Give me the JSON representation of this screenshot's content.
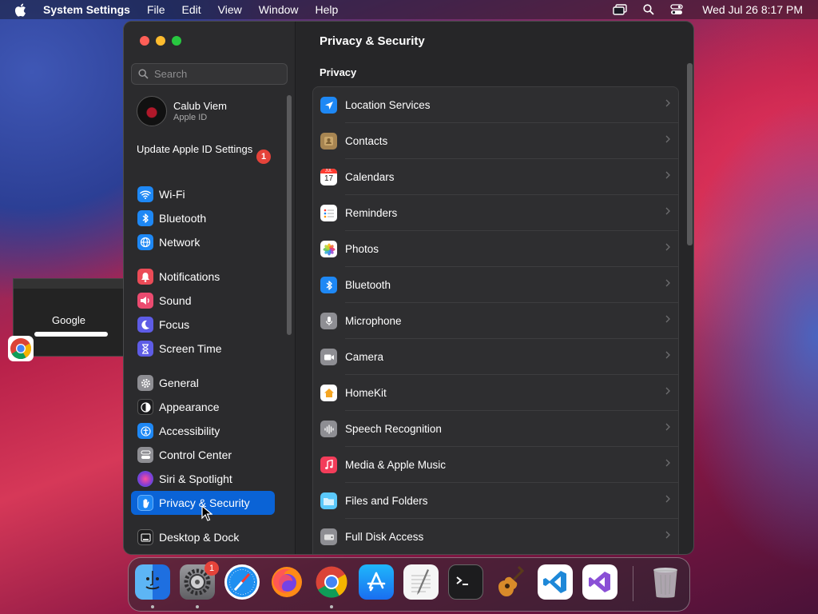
{
  "menubar": {
    "app_name": "System Settings",
    "menus": [
      "File",
      "Edit",
      "View",
      "Window",
      "Help"
    ],
    "datetime": "Wed Jul 26  8:17 PM"
  },
  "background_thumbnail": {
    "label": "Google"
  },
  "window": {
    "search_placeholder": "Search",
    "profile": {
      "name": "Calub Viem",
      "subtitle": "Apple ID"
    },
    "update": {
      "label": "Update Apple ID Settings",
      "badge": "1"
    },
    "sidebar": {
      "items": [
        {
          "label": "Wi-Fi",
          "icon": "wifi-icon",
          "color": "#1e88f5"
        },
        {
          "label": "Bluetooth",
          "icon": "bluetooth-icon",
          "color": "#1e88f5"
        },
        {
          "label": "Network",
          "icon": "globe-icon",
          "color": "#1e88f5"
        },
        {
          "label": "Notifications",
          "icon": "bell-icon",
          "color": "#eb4b57"
        },
        {
          "label": "Sound",
          "icon": "speaker-icon",
          "color": "#eb4b70"
        },
        {
          "label": "Focus",
          "icon": "moon-icon",
          "color": "#5e5ce6"
        },
        {
          "label": "Screen Time",
          "icon": "hourglass-icon",
          "color": "#5e5ce6"
        },
        {
          "label": "General",
          "icon": "gear-icon",
          "color": "#8e8e93"
        },
        {
          "label": "Appearance",
          "icon": "appearance-icon",
          "color": "#1c1c1e"
        },
        {
          "label": "Accessibility",
          "icon": "accessibility-icon",
          "color": "#1e88f5"
        },
        {
          "label": "Control Center",
          "icon": "control-center-icon",
          "color": "#8e8e93"
        },
        {
          "label": "Siri & Spotlight",
          "icon": "siri-icon",
          "color": "#b340c8"
        },
        {
          "label": "Privacy & Security",
          "icon": "hand-icon",
          "color": "#1e88f5",
          "selected": true
        },
        {
          "label": "Desktop & Dock",
          "icon": "desktop-icon",
          "color": "#1c1c1e"
        }
      ]
    },
    "content": {
      "title": "Privacy & Security",
      "section": "Privacy",
      "rows": [
        {
          "label": "Location Services",
          "icon": "location-arrow-icon",
          "color": "#1e88f5"
        },
        {
          "label": "Contacts",
          "icon": "contacts-icon",
          "color": "#a78552"
        },
        {
          "label": "Calendars",
          "icon": "calendar-icon",
          "color": "#ffffff"
        },
        {
          "label": "Reminders",
          "icon": "reminders-icon",
          "color": "#ffffff"
        },
        {
          "label": "Photos",
          "icon": "photos-icon",
          "color": "#ffffff"
        },
        {
          "label": "Bluetooth",
          "icon": "bluetooth-icon",
          "color": "#1e88f5"
        },
        {
          "label": "Microphone",
          "icon": "microphone-icon",
          "color": "#8e8e93"
        },
        {
          "label": "Camera",
          "icon": "camera-icon",
          "color": "#8e8e93"
        },
        {
          "label": "HomeKit",
          "icon": "home-icon",
          "color": "#f5a623"
        },
        {
          "label": "Speech Recognition",
          "icon": "waveform-icon",
          "color": "#8e8e93"
        },
        {
          "label": "Media & Apple Music",
          "icon": "music-note-icon",
          "color": "#f33d5a"
        },
        {
          "label": "Files and Folders",
          "icon": "folder-icon",
          "color": "#5ac8fa"
        },
        {
          "label": "Full Disk Access",
          "icon": "disk-icon",
          "color": "#8e8e93"
        }
      ],
      "calendar_month": "JUL",
      "calendar_day": "17"
    }
  },
  "dock": {
    "apps": [
      {
        "name": "Finder",
        "icon": "finder-icon",
        "running": true
      },
      {
        "name": "System Settings",
        "icon": "system-settings-icon",
        "running": true,
        "badge": "1"
      },
      {
        "name": "Safari",
        "icon": "safari-icon",
        "running": false
      },
      {
        "name": "Firefox",
        "icon": "firefox-icon",
        "running": false
      },
      {
        "name": "Google Chrome",
        "icon": "chrome-icon",
        "running": true
      },
      {
        "name": "App Store",
        "icon": "app-store-icon",
        "running": false
      },
      {
        "name": "TextEdit",
        "icon": "textedit-icon",
        "running": false
      },
      {
        "name": "Terminal",
        "icon": "terminal-icon",
        "running": false
      },
      {
        "name": "GarageBand",
        "icon": "guitar-icon",
        "running": false
      },
      {
        "name": "Visual Studio Code",
        "icon": "vscode-icon",
        "running": false
      },
      {
        "name": "Visual Studio",
        "icon": "visual-studio-icon",
        "running": false
      },
      {
        "name": "Trash",
        "icon": "trash-icon",
        "running": false
      }
    ]
  }
}
